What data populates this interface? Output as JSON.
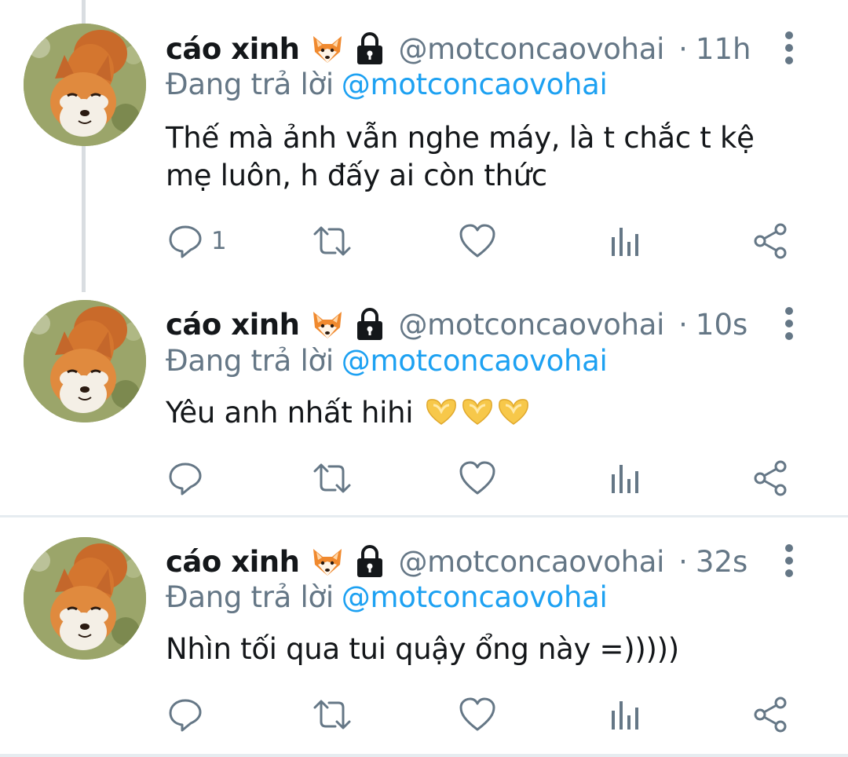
{
  "tweets": [
    {
      "name": "cáo xinh",
      "handle": "@motconcaovohai",
      "separator": "·",
      "time": "11h",
      "reply_prefix": "Đang trả lời",
      "reply_to": "@motconcaovohai",
      "text_line1": "Thế mà ảnh vẫn nghe máy, là t chắc t kệ",
      "text_line2": "mẹ luôn, h đấy ai còn thức",
      "reply_count": "1"
    },
    {
      "name": "cáo xinh",
      "handle": "@motconcaovohai",
      "separator": "·",
      "time": "10s",
      "reply_prefix": "Đang trả lời",
      "reply_to": "@motconcaovohai",
      "text": "Yêu anh nhất hihi",
      "emojis": [
        "heart-hands",
        "heart-hands",
        "heart-hands"
      ],
      "reply_count": ""
    },
    {
      "name": "cáo xinh",
      "handle": "@motconcaovohai",
      "separator": "·",
      "time": "32s",
      "reply_prefix": "Đang trả lời",
      "reply_to": "@motconcaovohai",
      "text": "Nhìn tối qua tui quậy ổng này =)))))",
      "reply_count": ""
    }
  ],
  "icons": {
    "name_badge_emoji": "fox-icon",
    "protected_badge": "lock-icon",
    "menu": "more-vertical-icon",
    "actions": [
      "reply-icon",
      "retweet-icon",
      "like-icon",
      "analytics-icon",
      "share-icon"
    ]
  },
  "colors": {
    "link": "#1da1f2",
    "secondary_text": "#657786",
    "primary_text": "#14171a",
    "divider": "#e6ecf0"
  }
}
